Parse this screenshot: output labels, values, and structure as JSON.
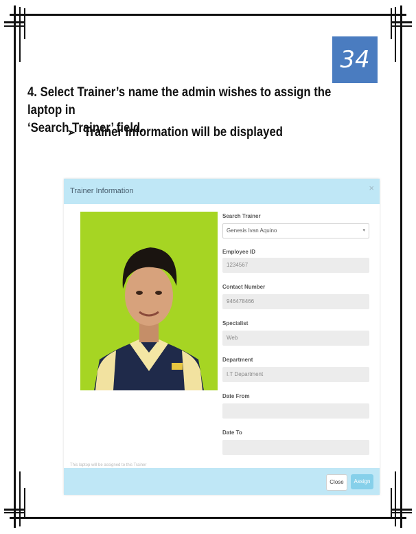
{
  "page_number": "34",
  "instruction": {
    "step_line1": "4. Select Trainer’s name the admin wishes to assign the laptop in",
    "step_line2": "‘Search Trainer’ field.",
    "bullet_icon": "arrow-bullet-icon",
    "bullet_text": "Trainer Information will be displayed"
  },
  "modal": {
    "title": "Trainer Information",
    "close_icon": "close-icon",
    "fields": {
      "search_trainer_label": "Search Trainer",
      "search_trainer_value": "Genesis Ivan Aquino",
      "employee_id_label": "Employee ID",
      "employee_id_value": "1234567",
      "contact_number_label": "Contact Number",
      "contact_number_value": "946478466",
      "specialist_label": "Specialist",
      "specialist_value": "Web",
      "department_label": "Department",
      "department_value": "I.T Department",
      "date_from_label": "Date From",
      "date_from_value": "",
      "date_to_label": "Date To",
      "date_to_value": ""
    },
    "footnote": "This laptop will be assigned to this Trainer",
    "buttons": {
      "close": "Close",
      "assign": "Assign"
    },
    "colors": {
      "header": "#bfe7f6",
      "assign": "#86d0ea",
      "photo_background": "#9fd11e"
    }
  }
}
